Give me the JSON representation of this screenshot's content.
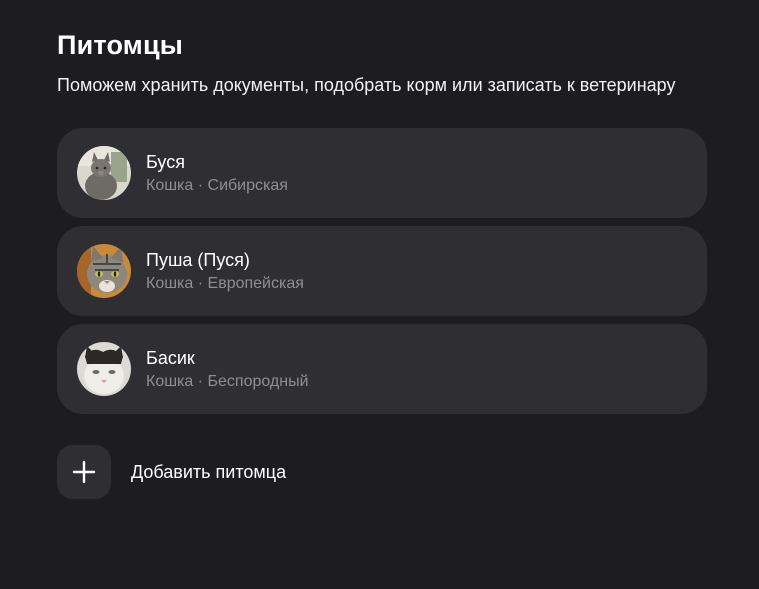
{
  "header": {
    "title": "Питомцы",
    "subtitle": "Поможем хранить документы, подобрать корм или записать к ветеринару"
  },
  "pets": [
    {
      "name": "Буся",
      "species": "Кошка",
      "breed": "Сибирская",
      "meta": "Кошка · Сибирская",
      "avatar_icon": "grey-cat-photo"
    },
    {
      "name": "Пуша (Пуся)",
      "species": "Кошка",
      "breed": "Европейская",
      "meta": "Кошка · Европейская",
      "avatar_icon": "tabby-cat-photo"
    },
    {
      "name": "Басик",
      "species": "Кошка",
      "breed": "Беспородный",
      "meta": "Кошка · Беспородный",
      "avatar_icon": "white-cat-photo"
    }
  ],
  "add_pet": {
    "label": "Добавить питомца",
    "icon": "plus-icon"
  },
  "colors": {
    "background": "#1d1d20",
    "card": "#2f2f33",
    "text": "#ffffff",
    "muted": "#8e8e93"
  }
}
